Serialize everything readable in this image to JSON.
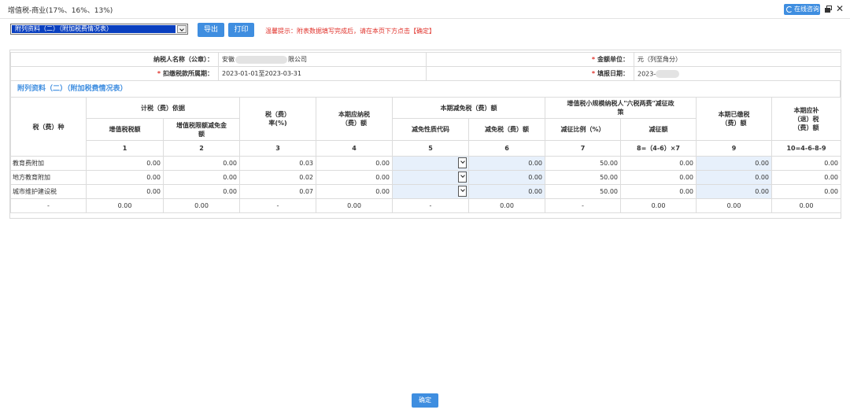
{
  "window": {
    "title": "增值税-商业(17%、16%、13%)",
    "online_query_label": "在线咨询"
  },
  "toolbar": {
    "select_value": "附列资料（二）（附加税费情况表）",
    "export_label": "导出",
    "print_label": "打印",
    "tip": "温馨提示：附表数据填写完成后，请在本页下方点击【确定】"
  },
  "info": {
    "taxpayer_label": "纳税人名称（公章）：",
    "taxpayer_prefix": "安徽",
    "taxpayer_suffix": "限公司",
    "unit_label": "金额单位：",
    "unit_value": "元（列至角分）",
    "period_label": "扣缴税款所属期：",
    "period_value": "2023-01-01至2023-03-31",
    "filing_date_label": "填报日期：",
    "filing_date_value": "2023-",
    "required_mark": "*"
  },
  "section_title": "附列资料（二）（附加税费情况表）",
  "table": {
    "headers": {
      "tax_type": "税（费）种",
      "basis": "计税（费）依据",
      "rate": "税（费）率(%)",
      "payable": "本期应纳税（费）额",
      "reduction": "本期减免税（费）额",
      "small_policy": "增值税小规模纳税人\"六税两费\"减征政策",
      "paid": "本期已缴税（费）额",
      "refund": "本期应补（退）税（费）额",
      "vat_amount": "增值税税额",
      "vat_exempt": "增值税限额减免金额",
      "reduction_code": "减免性质代码",
      "reduction_amount": "减免税（费）额",
      "reduction_ratio": "减征比例（%）",
      "reduction_sum": "减征额"
    },
    "col_numbers": [
      "1",
      "2",
      "3",
      "4",
      "5",
      "6",
      "7",
      "8=（4-6）×7",
      "9",
      "10=4-6-8-9"
    ],
    "rows": [
      {
        "name": "教育费附加",
        "c1": "0.00",
        "c2": "0.00",
        "c3": "0.03",
        "c4": "0.00",
        "c6": "0.00",
        "c7": "50.00",
        "c8": "0.00",
        "c9": "0.00",
        "c10": "0.00"
      },
      {
        "name": "地方教育附加",
        "c1": "0.00",
        "c2": "0.00",
        "c3": "0.02",
        "c4": "0.00",
        "c6": "0.00",
        "c7": "50.00",
        "c8": "0.00",
        "c9": "0.00",
        "c10": "0.00"
      },
      {
        "name": "城市维护建设税",
        "c1": "0.00",
        "c2": "0.00",
        "c3": "0.07",
        "c4": "0.00",
        "c6": "0.00",
        "c7": "50.00",
        "c8": "0.00",
        "c9": "0.00",
        "c10": "0.00"
      }
    ],
    "total": {
      "name": "-",
      "c1": "0.00",
      "c2": "0.00",
      "c3": "-",
      "c4": "0.00",
      "c5": "-",
      "c6": "0.00",
      "c7": "-",
      "c8": "0.00",
      "c9": "0.00",
      "c10": "0.00"
    }
  },
  "footer": {
    "confirm_label": "确定"
  }
}
